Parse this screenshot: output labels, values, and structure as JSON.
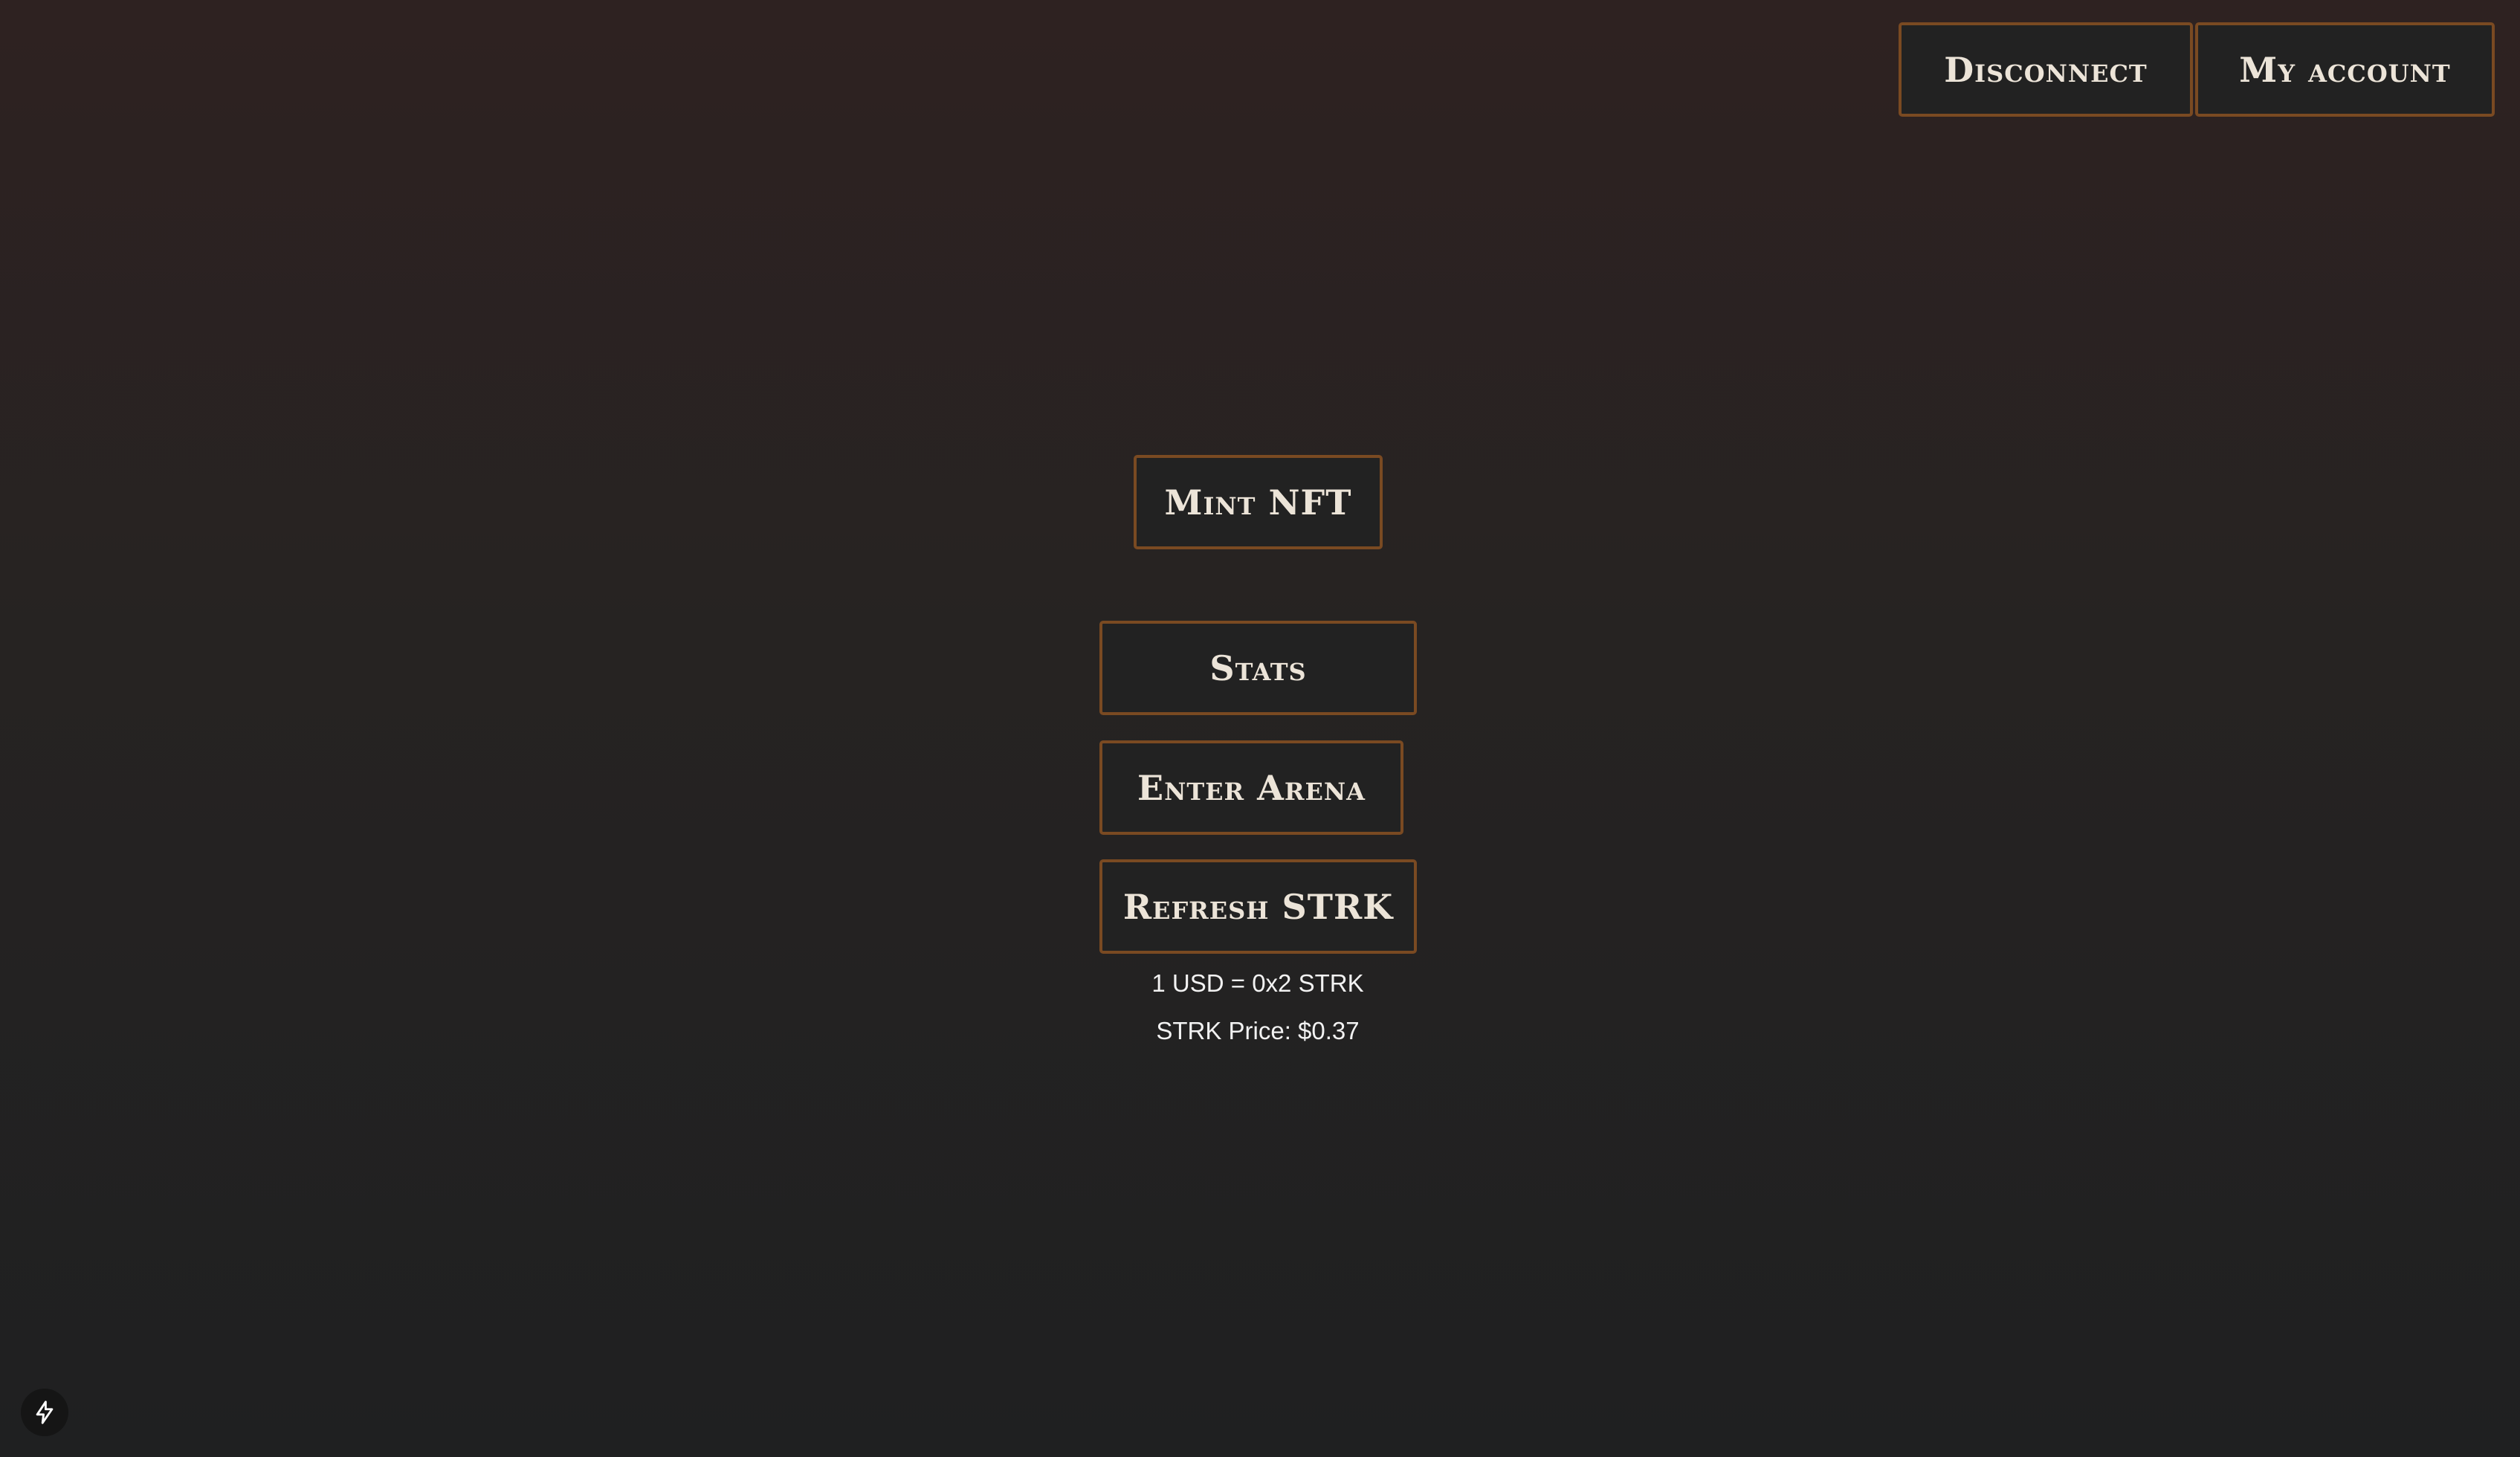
{
  "header": {
    "disconnect_label": "Disconnect",
    "account_label": "My account"
  },
  "main": {
    "mint_label": "Mint NFT",
    "stats_label": "Stats",
    "arena_label": "Enter Arena",
    "refresh_label": "Refresh STRK",
    "conversion_text": "1 USD = 0x2 STRK",
    "price_text": "STRK Price: $0.37"
  },
  "icons": {
    "corner_badge": "lightning-bolt-icon"
  },
  "colors": {
    "button_border": "#7a4a22",
    "button_background": "#222222",
    "button_text": "#ece4d8",
    "background_top": "#2e2221",
    "background_bottom": "#1f2021"
  }
}
